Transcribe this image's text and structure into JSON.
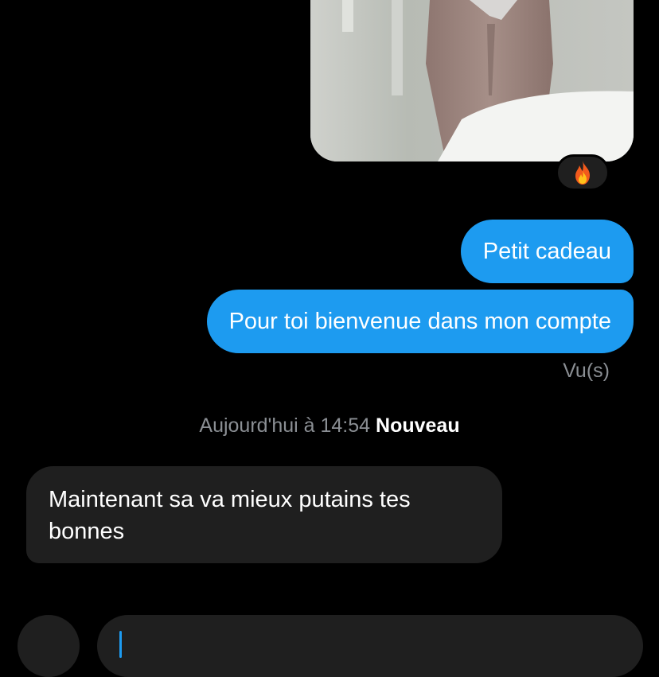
{
  "conversation": {
    "media_message": {
      "reaction_emoji": "🔥"
    },
    "outgoing_messages": [
      {
        "text": "Petit cadeau"
      },
      {
        "text": "Pour toi bienvenue dans mon compte"
      }
    ],
    "read_receipt": "Vu(s)",
    "separator": {
      "timestamp": "Aujourd'hui à 14:54",
      "new_label": "Nouveau"
    },
    "incoming_messages": [
      {
        "text": "Maintenant sa va mieux putains tes bonnes"
      }
    ]
  },
  "colors": {
    "outgoing_bubble": "#1d9bf0",
    "incoming_bubble": "#1f1f1f",
    "background": "#000000",
    "muted_text": "#8b8f94"
  },
  "icons": {
    "reaction": "fire-emoji",
    "composer_left": "composer-action-icon"
  }
}
